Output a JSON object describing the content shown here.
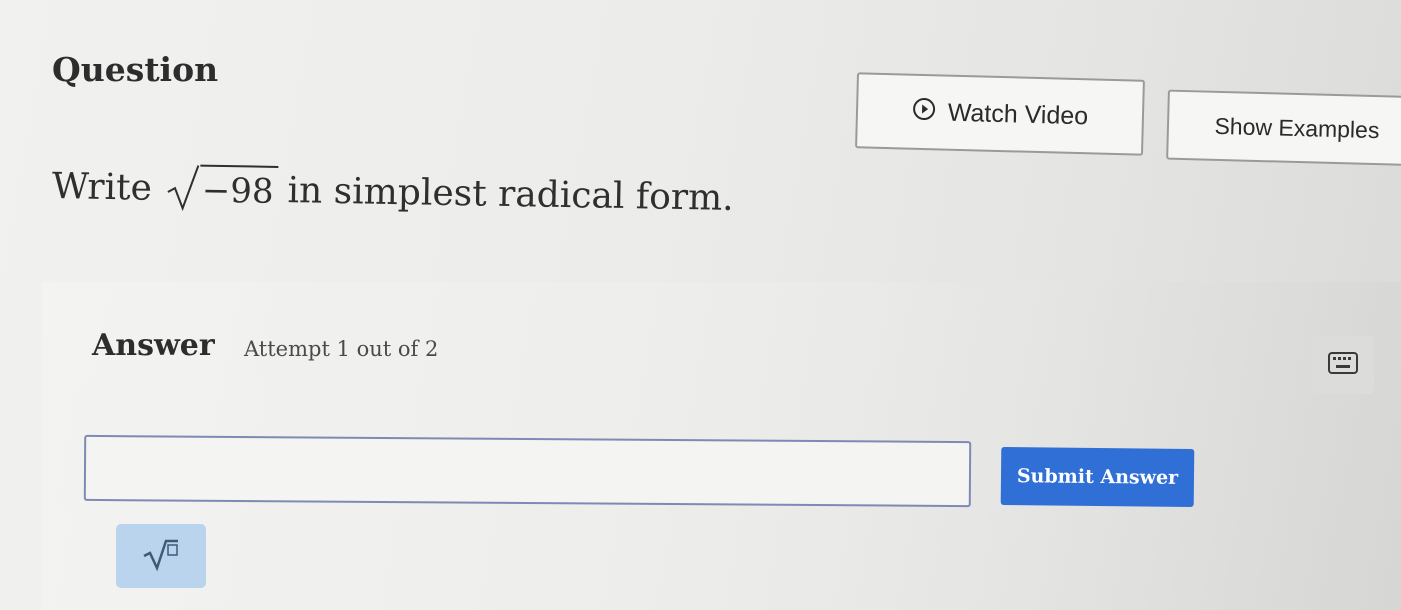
{
  "question": {
    "title": "Question",
    "watch_video_label": "Watch Video",
    "show_examples_label": "Show Examples",
    "prompt_prefix": "Write",
    "radicand": "−98",
    "prompt_suffix": "in simplest radical form."
  },
  "answer": {
    "label": "Answer",
    "attempt_text": "Attempt 1 out of 2",
    "input_value": "",
    "submit_label": "Submit Answer"
  },
  "icons": {
    "play": "play-circle-icon",
    "keyboard": "keyboard-icon",
    "math_tool": "square-root-icon"
  },
  "colors": {
    "submit_bg": "#2f6fd6",
    "math_tool_bg": "#b9d4ec",
    "input_border": "#7e8ab3"
  }
}
